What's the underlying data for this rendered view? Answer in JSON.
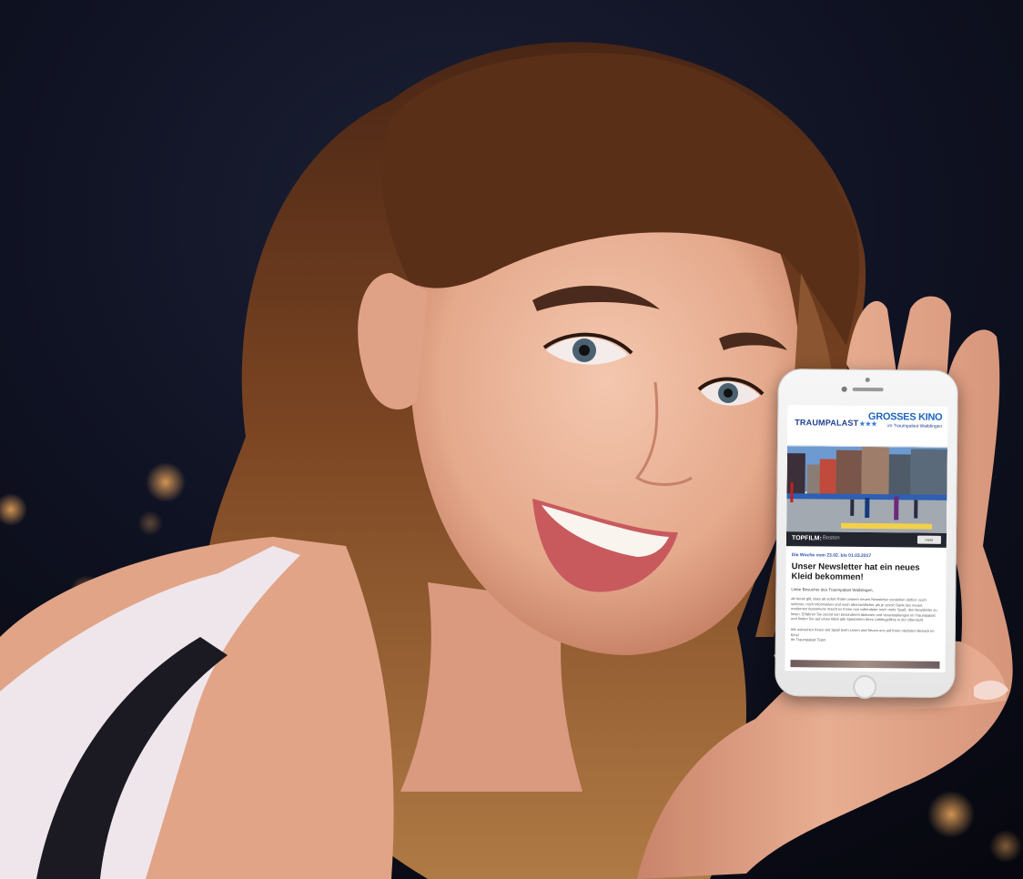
{
  "phone_screen": {
    "logo": "TRAUMPALAST",
    "logo_stars": "★★★",
    "tagline": "GROSSES KINO",
    "tagline_sub": "im Traumpalast Waiblingen",
    "topfilm_label": "TOPFILM:",
    "topfilm_title": "Boston",
    "topfilm_button": "mehr",
    "week_line": "Die Woche vom 23.02. bis 01.03.2017",
    "headline": "Unser Newsletter hat ein neues Kleid bekommen!",
    "greeting": "Liebe Besucher des Traumpalast Waiblingen,",
    "body": "ab heute gilt, dass ab sofort findet unserer neuen Newsletter vorstellen dürfen: noch schöner, noch informativer und noch übersichtlicher als je zuvor! Dank des neuen, modernen Aussehens macht es Ihnen nun vollendeter noch mehr Spaß, den Newsletter zu lesen. Erfahren Sie zuerst von besonderen Aktionen und Veranstaltungen im Traumpalast und finden Sie auf einen Blick alle Spielzeiten Ihres Lieblingsfilms in der Übersicht.",
    "closing": "Wir wünschen Ihnen viel Spaß beim Lesen und freuen uns auf Ihren nächsten Besuch im Kino!",
    "signoff": "Ihr Traumpalast Team"
  },
  "colors": {
    "background": "#0b0d18",
    "hair": "#6b3a1f",
    "skin": "#e8b196",
    "brand_blue": "#1f3c8f",
    "tagline_blue": "#1f66c0",
    "topfilm_bar": "#23262e"
  }
}
